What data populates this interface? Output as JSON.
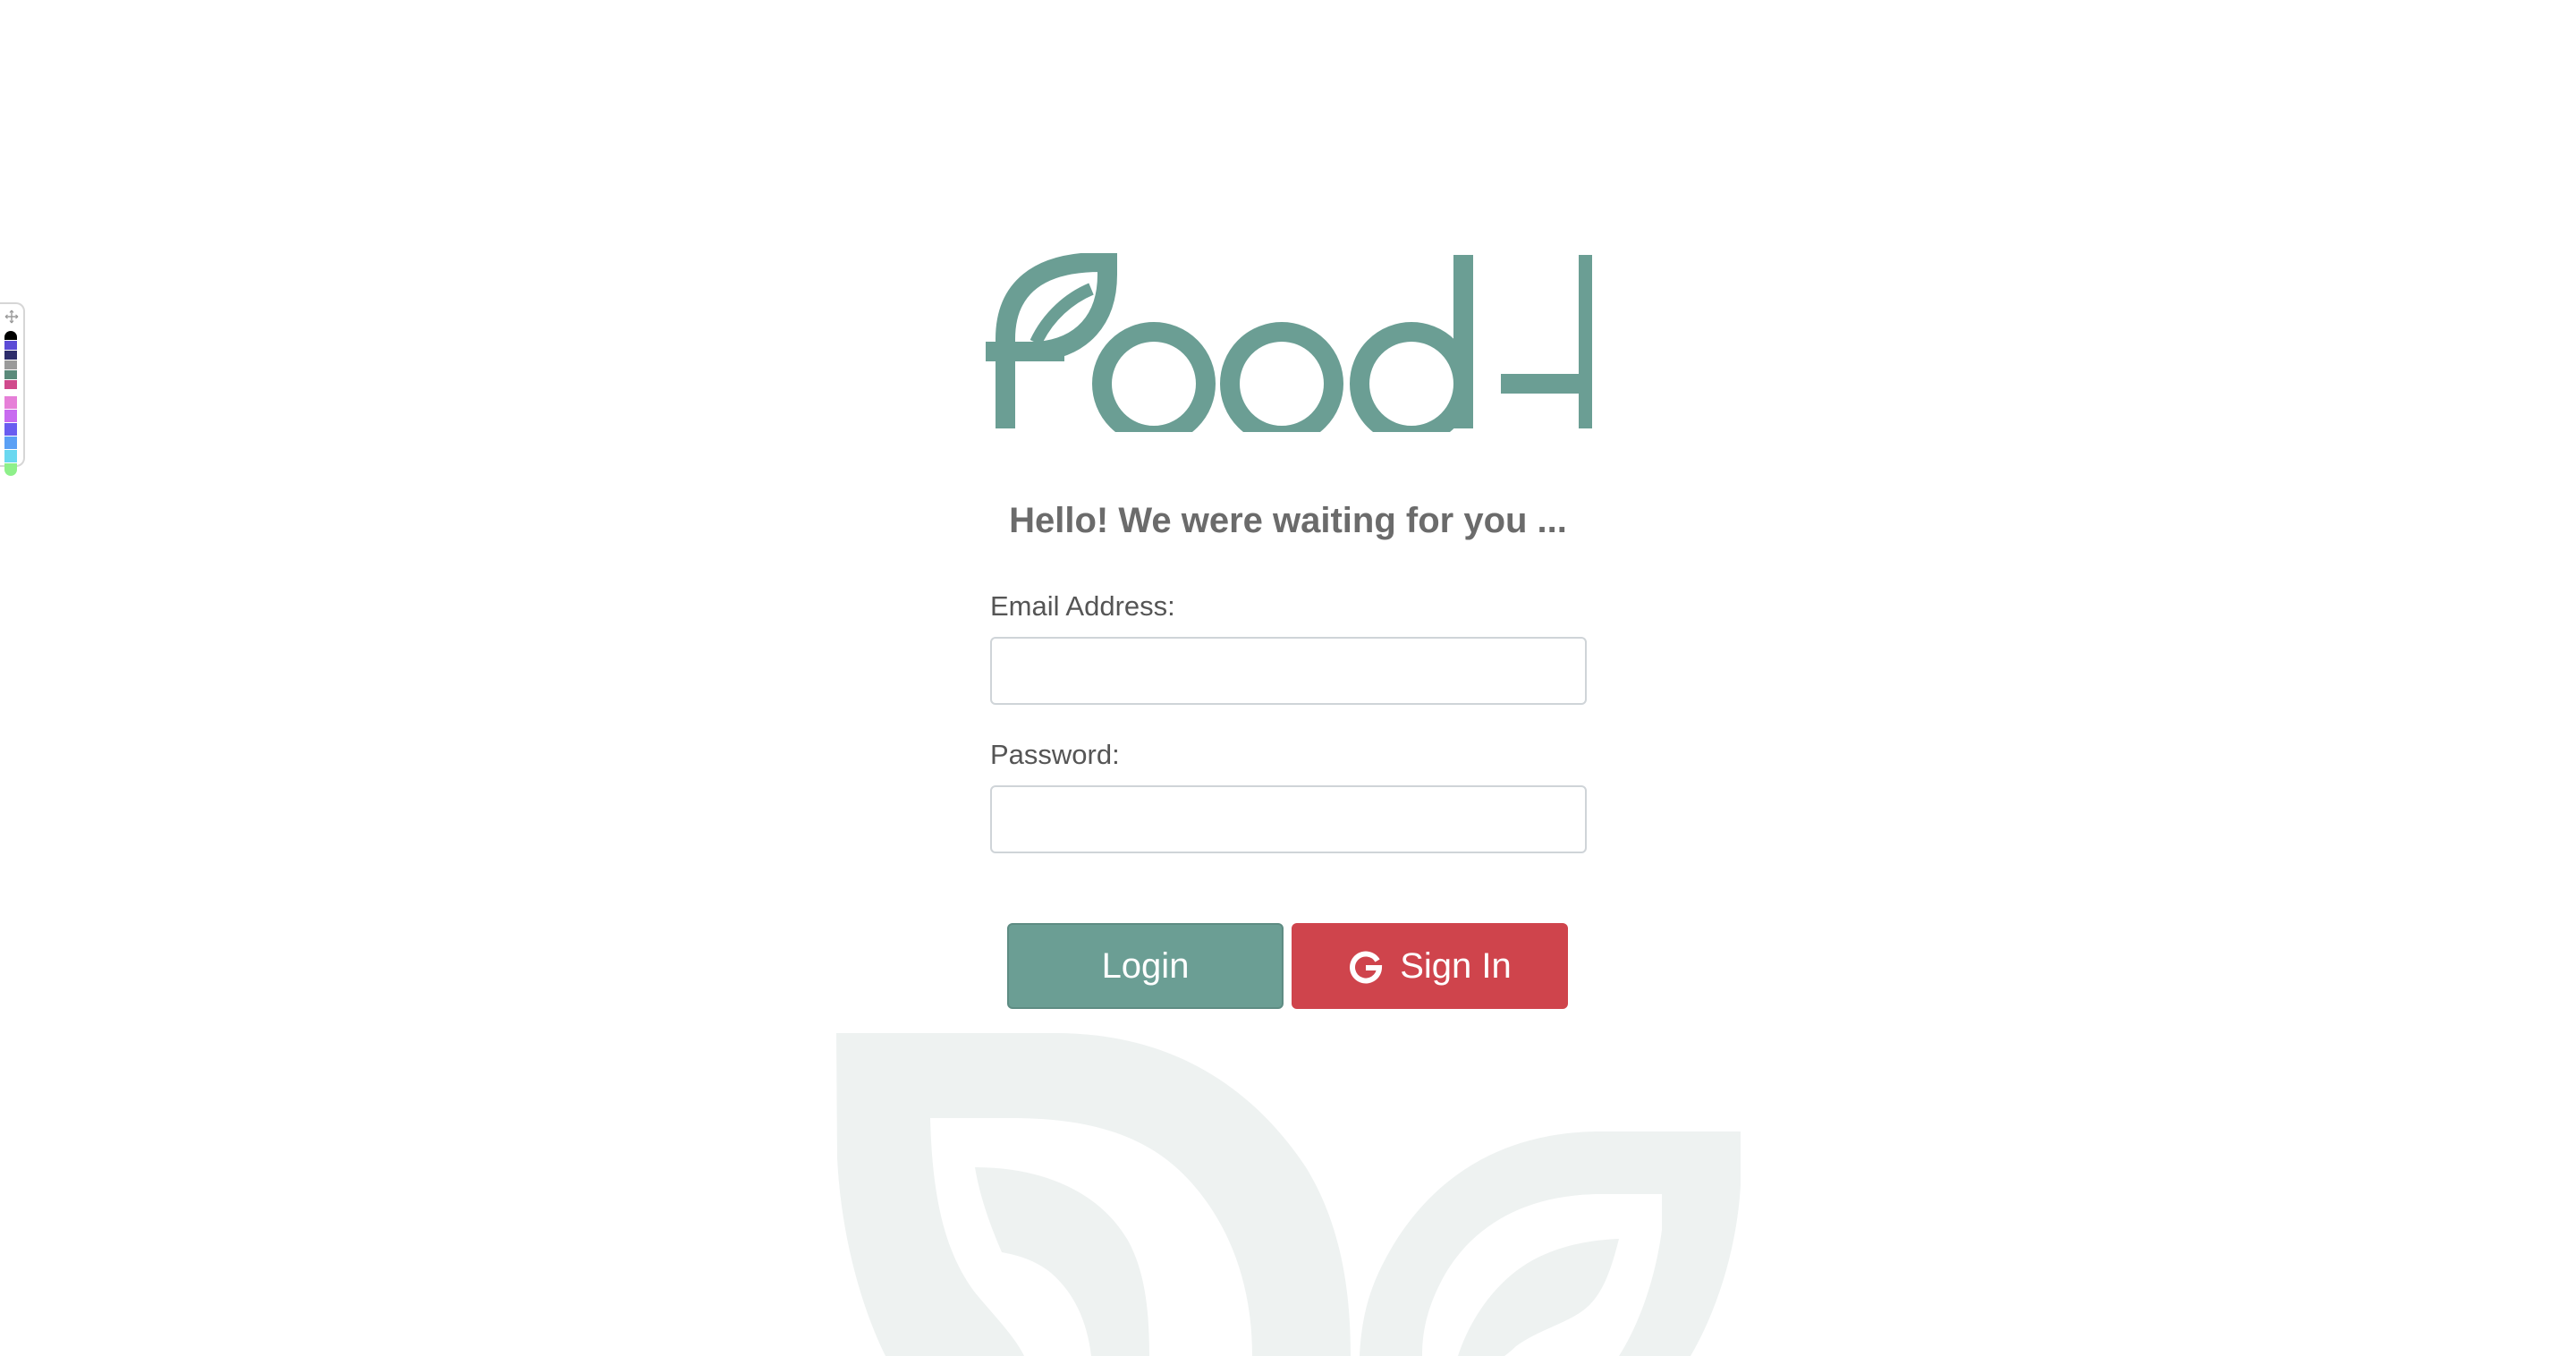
{
  "brand": {
    "logo_text": "foodel",
    "color": "#6b9e94"
  },
  "greeting": "Hello! We were waiting for you ...",
  "form": {
    "email_label": "Email Address:",
    "email_value": "",
    "password_label": "Password:",
    "password_value": ""
  },
  "buttons": {
    "login_label": "Login",
    "login_color": "#6b9e94",
    "google_label": "Sign In",
    "google_color": "#cf444c",
    "google_icon": "google-g-icon"
  },
  "palette": {
    "icon": "move-icon",
    "colors": [
      "#000000",
      "#5b4bd6",
      "#2d2d6b",
      "#9a9a9a",
      "#5a8a7a",
      "#d04a8c",
      "#e67fd8",
      "#c86bf0",
      "#6a5cf0",
      "#5aa0f5",
      "#6ad8f0",
      "#8ef08a"
    ]
  }
}
